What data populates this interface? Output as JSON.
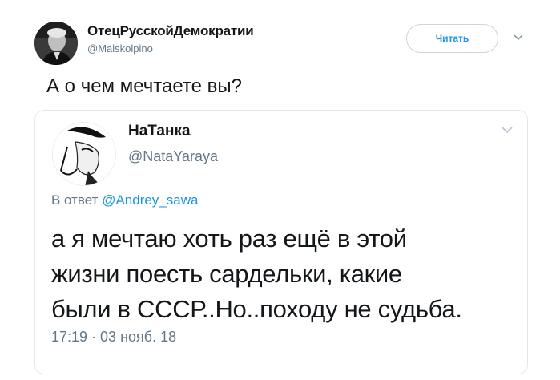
{
  "outer_tweet": {
    "author_name": "ОтецРусскойДемократии",
    "author_handle": "@Maiskolpino",
    "follow_label": "Читать",
    "text": "А о чем мечтаете вы?"
  },
  "quoted_tweet": {
    "author_name": "НаТанка",
    "author_handle": "@NataYaraya",
    "reply_prefix": "В ответ",
    "reply_to": "@Andrey_sawa",
    "text_lines": [
      "а я мечтаю хоть раз ещё в этой",
      "жизни поесть сардельки, какие",
      "были в СССР..Но..походу не судьба."
    ],
    "timestamp": "17:19 · 03 нояб. 18"
  },
  "colors": {
    "link": "#1b95e0",
    "secondary_text": "#657786",
    "border": "#e1e8ed"
  },
  "icons": {
    "outer_menu": "chevron-down-icon",
    "quote_menu": "chevron-down-icon"
  }
}
